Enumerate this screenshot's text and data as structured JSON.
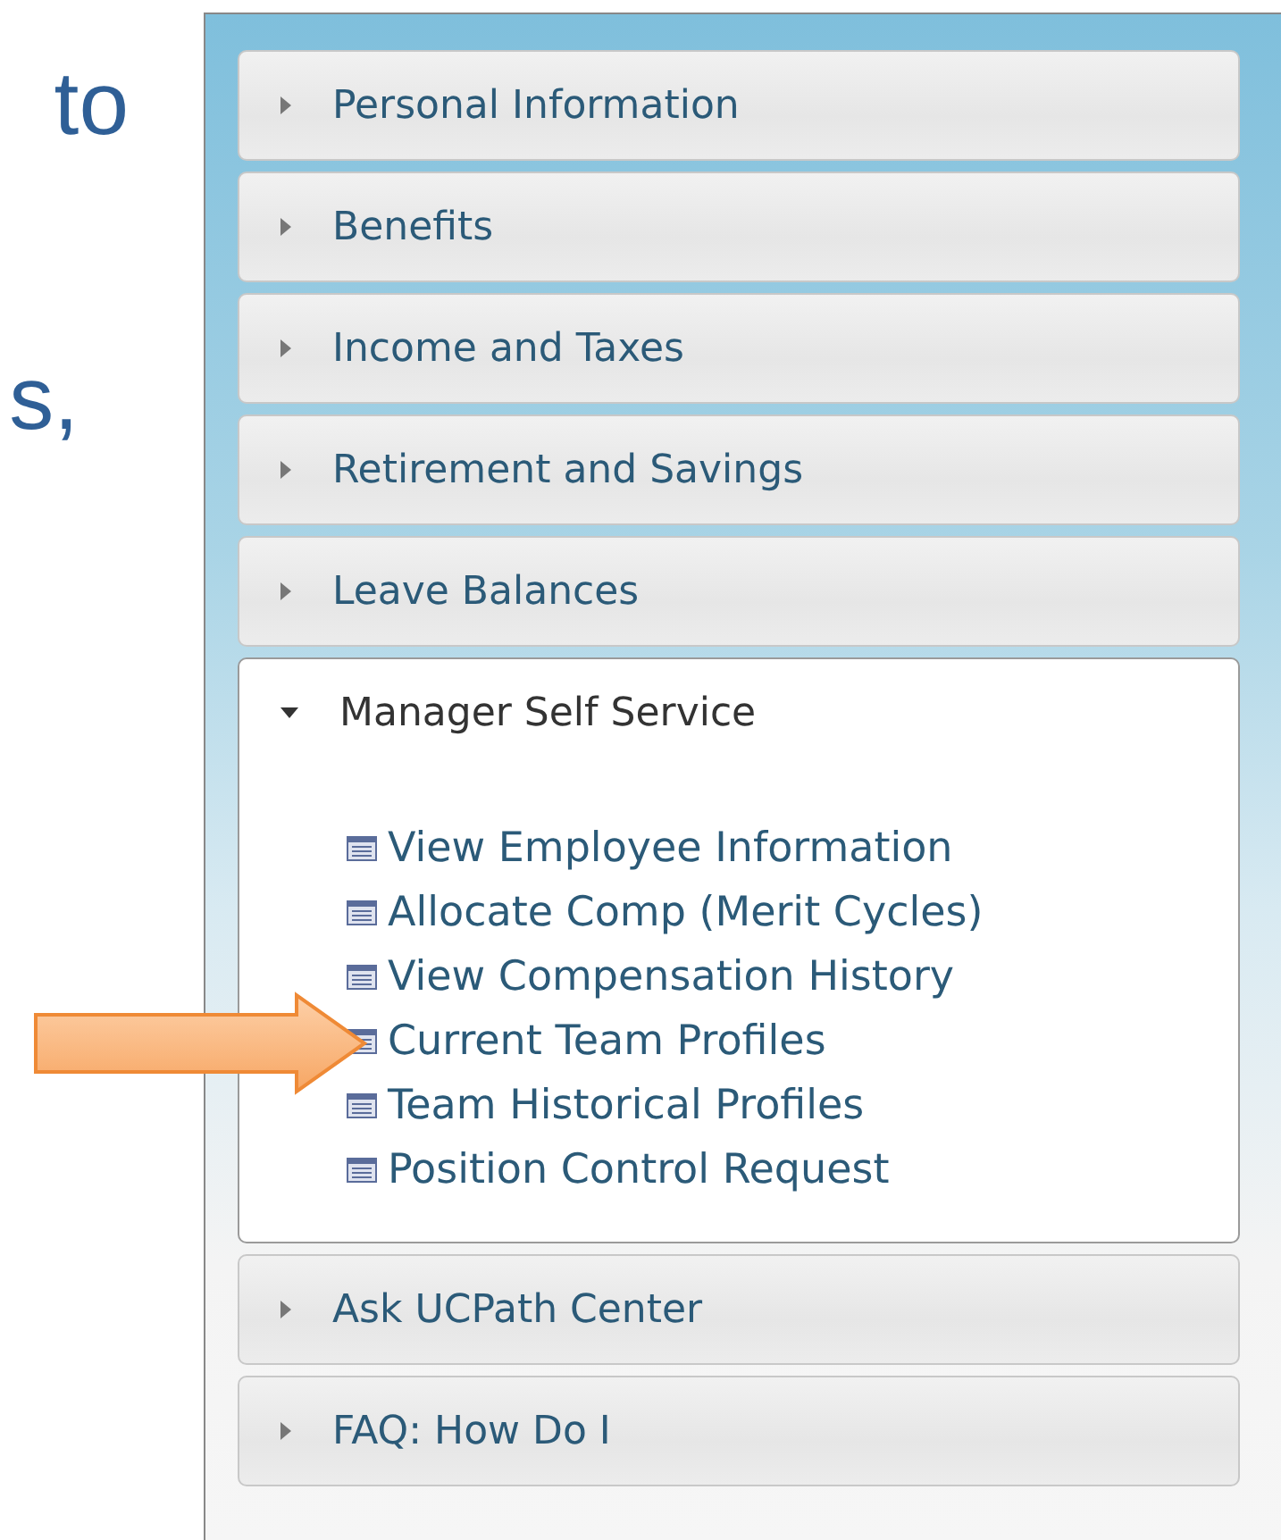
{
  "slide_text": [
    "to",
    "s,"
  ],
  "sections": [
    {
      "title": "Personal Information",
      "expanded": false
    },
    {
      "title": "Benefits",
      "expanded": false
    },
    {
      "title": "Income and Taxes",
      "expanded": false
    },
    {
      "title": "Retirement and Savings",
      "expanded": false
    },
    {
      "title": "Leave Balances",
      "expanded": false
    },
    {
      "title": "Manager Self Service",
      "expanded": true,
      "items": [
        "View Employee Information",
        "Allocate Comp (Merit Cycles)",
        "View Compensation History",
        "Current Team Profiles",
        "Team Historical Profiles",
        "Position Control Request"
      ]
    },
    {
      "title": "Ask UCPath Center",
      "expanded": false
    },
    {
      "title": "FAQ: How Do I",
      "expanded": false
    }
  ]
}
